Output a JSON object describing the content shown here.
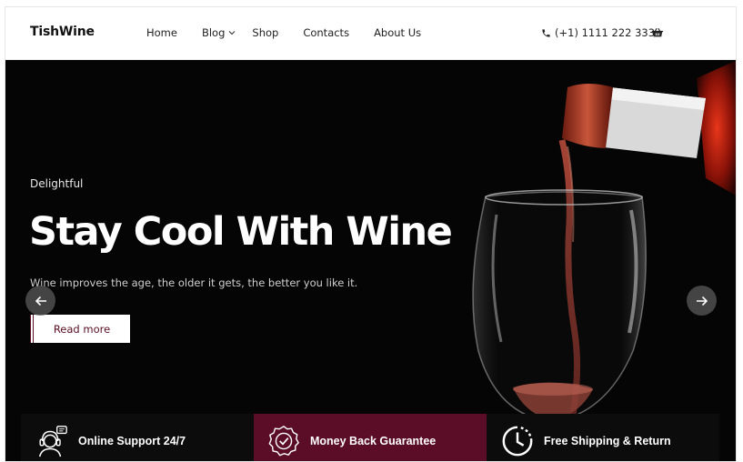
{
  "brand": {
    "logo": "TishWine"
  },
  "nav": {
    "items": [
      {
        "label": "Home"
      },
      {
        "label": "Blog"
      },
      {
        "label": "Shop"
      },
      {
        "label": "Contacts"
      },
      {
        "label": "About Us"
      }
    ]
  },
  "header": {
    "phone": "(+1) 1111 222 333",
    "phone_icon": "phone-icon",
    "cart_icon": "basket-icon"
  },
  "hero": {
    "eyebrow": "Delightful",
    "headline": "Stay Cool With Wine",
    "subtext": "Wine improves the age, the older it gets, the better you like it.",
    "cta": "Read more",
    "prev_icon": "arrow-left-icon",
    "next_icon": "arrow-right-icon"
  },
  "features": [
    {
      "label": "Online Support 24/7",
      "icon": "support-agent-icon"
    },
    {
      "label": "Money Back Guarantee",
      "icon": "money-back-badge-icon"
    },
    {
      "label": "Free Shipping & Return",
      "icon": "clock-icon"
    }
  ],
  "colors": {
    "accent": "#5b0d27",
    "hero_bg": "#050505",
    "feature_bg": "#0c0c0c"
  }
}
